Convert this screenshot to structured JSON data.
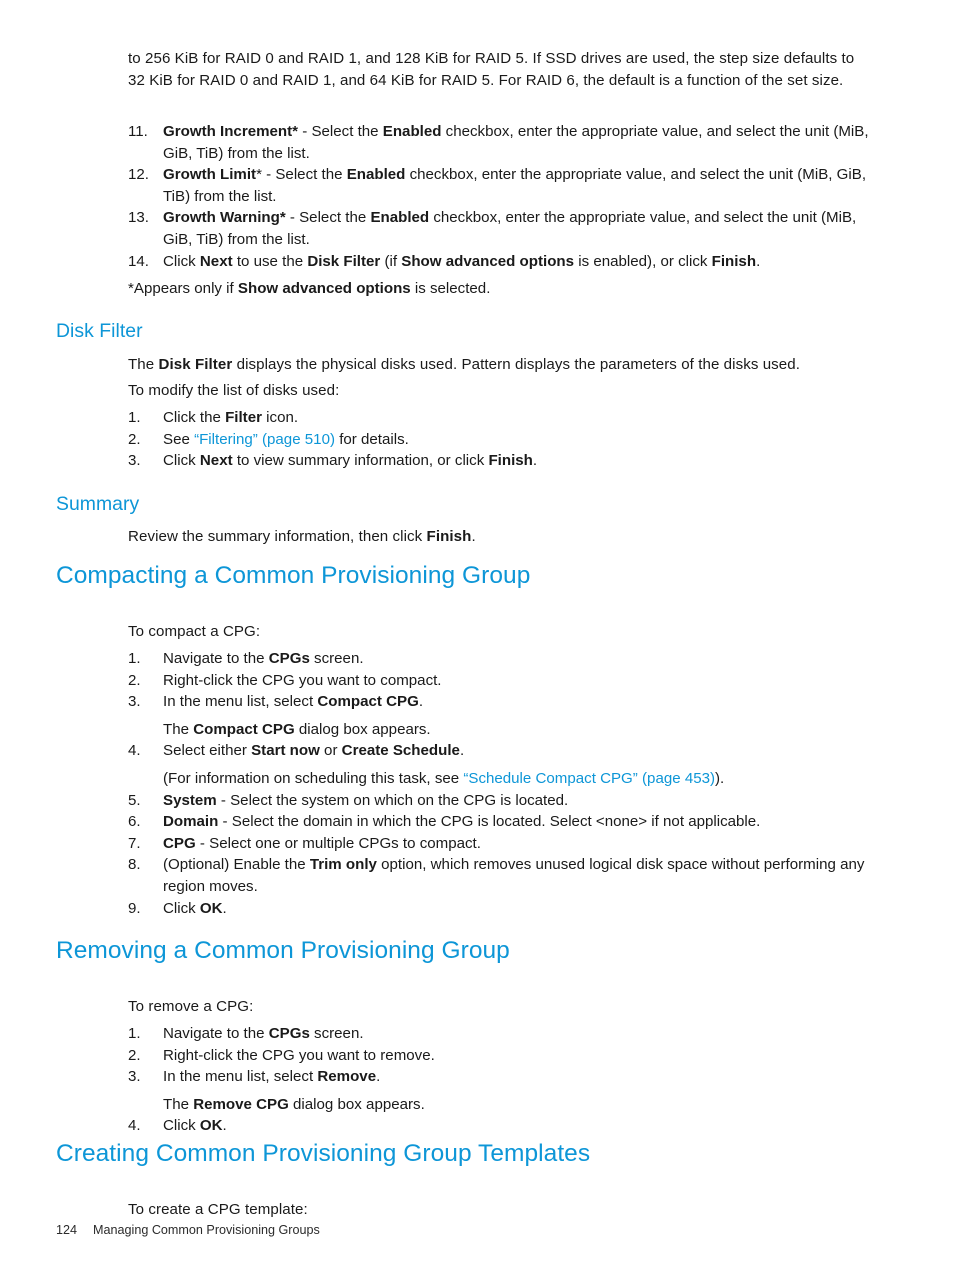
{
  "page": {
    "number": "124",
    "running_footer": "Managing Common Provisioning Groups",
    "accent_color": "#0d96d7",
    "text_color": "#1a1a1a",
    "background_color": "#ffffff"
  },
  "continuation_paragraph": {
    "text": "to 256 KiB for RAID 0 and RAID 1, and 128 KiB for RAID 5. If SSD drives are used, the step size defaults to 32 KiB for RAID 0 and RAID 1, and 64 KiB for RAID 5. For RAID 6, the default is a function of the set size."
  },
  "continued_list": {
    "items": [
      {
        "num": "11.",
        "segments": [
          {
            "bold": true,
            "text": "Growth Increment*"
          },
          {
            "bold": false,
            "text": " - Select the "
          },
          {
            "bold": true,
            "text": "Enabled"
          },
          {
            "bold": false,
            "text": " checkbox, enter the appropriate value, and select the unit (MiB, GiB, TiB) from the list."
          }
        ]
      },
      {
        "num": "12.",
        "segments": [
          {
            "bold": true,
            "text": "Growth Limit"
          },
          {
            "bold": false,
            "text": "* - Select the "
          },
          {
            "bold": true,
            "text": "Enabled"
          },
          {
            "bold": false,
            "text": " checkbox, enter the appropriate value, and select the unit (MiB, GiB, TiB) from the list."
          }
        ]
      },
      {
        "num": "13.",
        "segments": [
          {
            "bold": true,
            "text": "Growth Warning*"
          },
          {
            "bold": false,
            "text": " - Select the "
          },
          {
            "bold": true,
            "text": "Enabled"
          },
          {
            "bold": false,
            "text": " checkbox, enter the appropriate value, and select the unit (MiB, GiB, TiB) from the list."
          }
        ]
      },
      {
        "num": "14.",
        "segments": [
          {
            "bold": false,
            "text": "Click "
          },
          {
            "bold": true,
            "text": "Next"
          },
          {
            "bold": false,
            "text": " to use the "
          },
          {
            "bold": true,
            "text": "Disk Filter"
          },
          {
            "bold": false,
            "text": " (if "
          },
          {
            "bold": true,
            "text": "Show advanced options"
          },
          {
            "bold": false,
            "text": " is enabled), or click "
          },
          {
            "bold": true,
            "text": "Finish"
          },
          {
            "bold": false,
            "text": "."
          }
        ]
      }
    ],
    "footnote_segments": [
      {
        "bold": false,
        "text": "*Appears only if "
      },
      {
        "bold": true,
        "text": "Show advanced options"
      },
      {
        "bold": false,
        "text": " is selected."
      }
    ]
  },
  "disk_filter_section": {
    "heading": "Disk Filter",
    "intro_segments": [
      {
        "bold": false,
        "text": "The "
      },
      {
        "bold": true,
        "text": "Disk Filter"
      },
      {
        "bold": false,
        "text": " displays the physical disks used. Pattern displays the parameters of the disks used."
      }
    ],
    "lead_in": "To modify the list of disks used:",
    "items": [
      {
        "num": "1.",
        "segments": [
          {
            "bold": false,
            "text": "Click the "
          },
          {
            "bold": true,
            "text": "Filter"
          },
          {
            "bold": false,
            "text": " icon."
          }
        ]
      },
      {
        "num": "2.",
        "segments": [
          {
            "bold": false,
            "text": "See "
          },
          {
            "link": true,
            "text": "“Filtering” (page 510)"
          },
          {
            "bold": false,
            "text": " for details."
          }
        ]
      },
      {
        "num": "3.",
        "segments": [
          {
            "bold": false,
            "text": "Click "
          },
          {
            "bold": true,
            "text": "Next"
          },
          {
            "bold": false,
            "text": " to view summary information, or click "
          },
          {
            "bold": true,
            "text": "Finish"
          },
          {
            "bold": false,
            "text": "."
          }
        ]
      }
    ]
  },
  "summary_section": {
    "heading": "Summary",
    "body_segments": [
      {
        "bold": false,
        "text": "Review the summary information, then click "
      },
      {
        "bold": true,
        "text": "Finish"
      },
      {
        "bold": false,
        "text": "."
      }
    ]
  },
  "compacting_section": {
    "heading": "Compacting a Common Provisioning Group",
    "lead_in": "To compact a CPG:",
    "items": [
      {
        "num": "1.",
        "segments": [
          {
            "bold": false,
            "text": "Navigate to the "
          },
          {
            "bold": true,
            "text": "CPGs"
          },
          {
            "bold": false,
            "text": " screen."
          }
        ]
      },
      {
        "num": "2.",
        "segments": [
          {
            "bold": false,
            "text": "Right-click the CPG you want to compact."
          }
        ]
      },
      {
        "num": "3.",
        "segments": [
          {
            "bold": false,
            "text": "In the menu list, select "
          },
          {
            "bold": true,
            "text": "Compact CPG"
          },
          {
            "bold": false,
            "text": "."
          }
        ],
        "sub_segments": [
          {
            "bold": false,
            "text": "The "
          },
          {
            "bold": true,
            "text": "Compact CPG"
          },
          {
            "bold": false,
            "text": " dialog box appears."
          }
        ]
      },
      {
        "num": "4.",
        "segments": [
          {
            "bold": false,
            "text": "Select either "
          },
          {
            "bold": true,
            "text": "Start now"
          },
          {
            "bold": false,
            "text": " or "
          },
          {
            "bold": true,
            "text": "Create Schedule"
          },
          {
            "bold": false,
            "text": "."
          }
        ],
        "sub_segments": [
          {
            "bold": false,
            "text": "(For information on scheduling this task, see "
          },
          {
            "link": true,
            "text": "“Schedule Compact CPG” (page 453)"
          },
          {
            "bold": false,
            "text": ")."
          }
        ]
      },
      {
        "num": "5.",
        "segments": [
          {
            "bold": true,
            "text": "System"
          },
          {
            "bold": false,
            "text": " - Select the system on which on the CPG is located."
          }
        ]
      },
      {
        "num": "6.",
        "segments": [
          {
            "bold": true,
            "text": "Domain"
          },
          {
            "bold": false,
            "text": " - Select the domain in which the CPG is located. Select <none> if not applicable."
          }
        ]
      },
      {
        "num": "7.",
        "segments": [
          {
            "bold": true,
            "text": "CPG"
          },
          {
            "bold": false,
            "text": " - Select one or multiple CPGs to compact."
          }
        ]
      },
      {
        "num": "8.",
        "segments": [
          {
            "bold": false,
            "text": "(Optional) Enable the "
          },
          {
            "bold": true,
            "text": "Trim only"
          },
          {
            "bold": false,
            "text": " option, which removes unused logical disk space without performing any region moves."
          }
        ]
      },
      {
        "num": "9.",
        "segments": [
          {
            "bold": false,
            "text": "Click "
          },
          {
            "bold": true,
            "text": "OK"
          },
          {
            "bold": false,
            "text": "."
          }
        ]
      }
    ]
  },
  "removing_section": {
    "heading": "Removing a Common Provisioning Group",
    "lead_in": "To remove a CPG:",
    "items": [
      {
        "num": "1.",
        "segments": [
          {
            "bold": false,
            "text": "Navigate to the "
          },
          {
            "bold": true,
            "text": "CPGs"
          },
          {
            "bold": false,
            "text": " screen."
          }
        ]
      },
      {
        "num": "2.",
        "segments": [
          {
            "bold": false,
            "text": "Right-click the CPG you want to remove."
          }
        ]
      },
      {
        "num": "3.",
        "segments": [
          {
            "bold": false,
            "text": "In the menu list, select "
          },
          {
            "bold": true,
            "text": "Remove"
          },
          {
            "bold": false,
            "text": "."
          }
        ],
        "sub_segments": [
          {
            "bold": false,
            "text": "The "
          },
          {
            "bold": true,
            "text": "Remove CPG"
          },
          {
            "bold": false,
            "text": " dialog box appears."
          }
        ]
      },
      {
        "num": "4.",
        "segments": [
          {
            "bold": false,
            "text": "Click "
          },
          {
            "bold": true,
            "text": "OK"
          },
          {
            "bold": false,
            "text": "."
          }
        ]
      }
    ]
  },
  "creating_templates_section": {
    "heading": "Creating Common Provisioning Group Templates",
    "lead_in": "To create a CPG template:"
  }
}
